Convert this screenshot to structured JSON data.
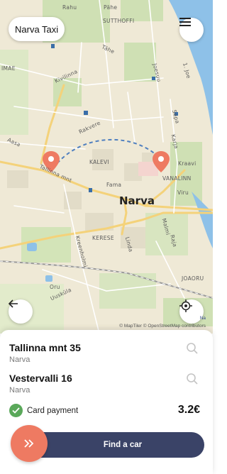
{
  "app": {
    "brand_label": "Narva Taxi"
  },
  "map": {
    "city_label": "Narva",
    "place_labels": [
      "Rahu",
      "Pähe",
      "SUTTHOFFI",
      "Kivilinna",
      "Tähe",
      "Joesuu",
      "1. Joe",
      "Rakvere",
      "Aasa",
      "Tallinna mnt",
      "KALEVI",
      "Fama",
      "Sepa",
      "Karja",
      "Kraavi",
      "VANALINN",
      "Viru",
      "Malmi",
      "Raja",
      "KERESE",
      "Linda",
      "Kreenholmi",
      "Oru",
      "Uusküla",
      "JOAORU",
      "IMAE"
    ],
    "attribution": "© MapTiler © OpenStreetMap contributors",
    "attribution_partial": "Na"
  },
  "icons": {
    "menu": "hamburger-icon",
    "back": "arrow-left-icon",
    "locate": "crosshair-icon",
    "search": "search-icon",
    "check": "check-icon",
    "go": "double-chevron-right-icon",
    "pin": "map-pin-icon"
  },
  "route": {
    "origin": {
      "street": "Tallinna mnt 35",
      "city": "Narva"
    },
    "destination": {
      "street": "Vestervalli 16",
      "city": "Narva"
    }
  },
  "payment": {
    "label": "Card payment",
    "price": "3.2€"
  },
  "actions": {
    "find_car": "Find a car"
  },
  "colors": {
    "pin": "#ee7a62",
    "primary": "#3a4367",
    "accent": "#ee7a62",
    "check": "#5aa85a",
    "route_dash": "#4f7fbf"
  }
}
